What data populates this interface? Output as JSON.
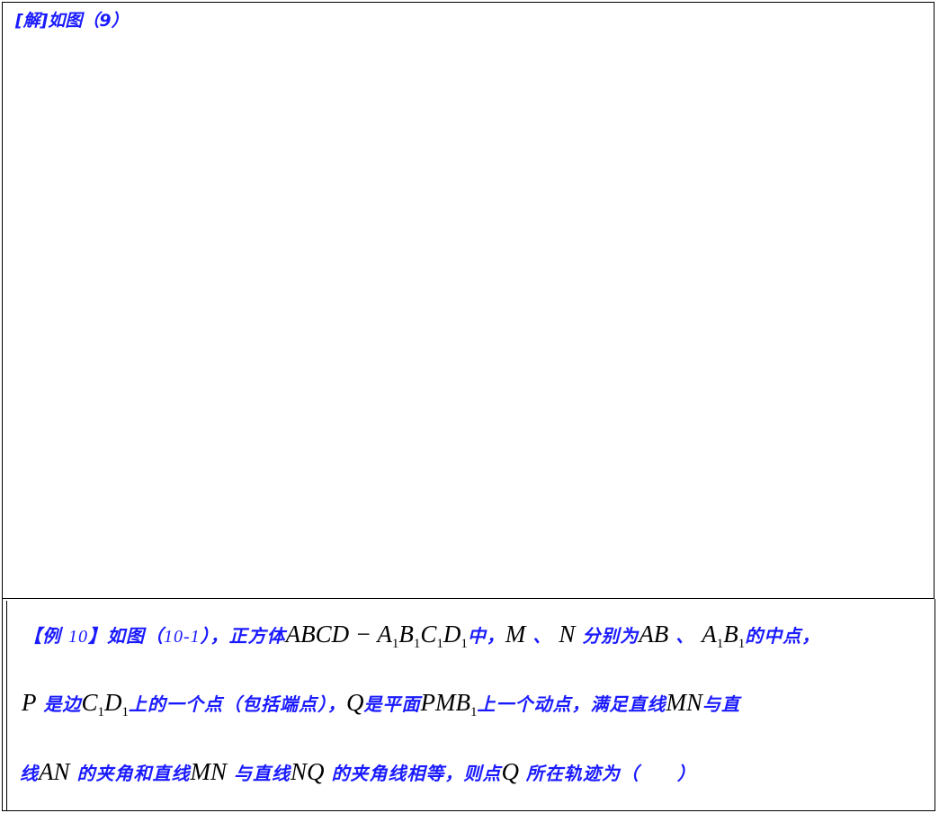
{
  "solution": {
    "label": "[解]如图（9）"
  },
  "problem": {
    "line1": {
      "open_bracket": "【",
      "ex_word": "例",
      "ex_num": "10",
      "close_bracket": "】",
      "t1": "如图（",
      "fig": "10-1",
      "t2": "），正方体",
      "cube_base": "ABCD",
      "minus": " − ",
      "A1": "A",
      "B1": "B",
      "C1": "C",
      "D1": "D",
      "sub1": "1",
      "t3": "中，",
      "M": "M",
      "t4": "、",
      "N": "N",
      "t5": "分别为",
      "AB": "AB",
      "t6": "、",
      "A1b": "A",
      "B1b": "B",
      "t7": "的中点，"
    },
    "line2": {
      "P": "P",
      "t1": "是边",
      "C": "C",
      "D": "D",
      "sub1": "1",
      "t2": "上的一个点（包括端点），",
      "Q": "Q",
      "t3": "是平面",
      "PMB": "PMB",
      "t4": "上一个动点，满足直线",
      "MN": "MN",
      "t5": "与直"
    },
    "line3": {
      "t1": "线",
      "AN": "AN",
      "t2": "的夹角和直线",
      "MN": "MN",
      "t3": "与直线",
      "NQ": "NQ",
      "t4": "的夹角线相等，则点",
      "Q": "Q",
      "t5": "所在轨迹为（　　）"
    }
  }
}
